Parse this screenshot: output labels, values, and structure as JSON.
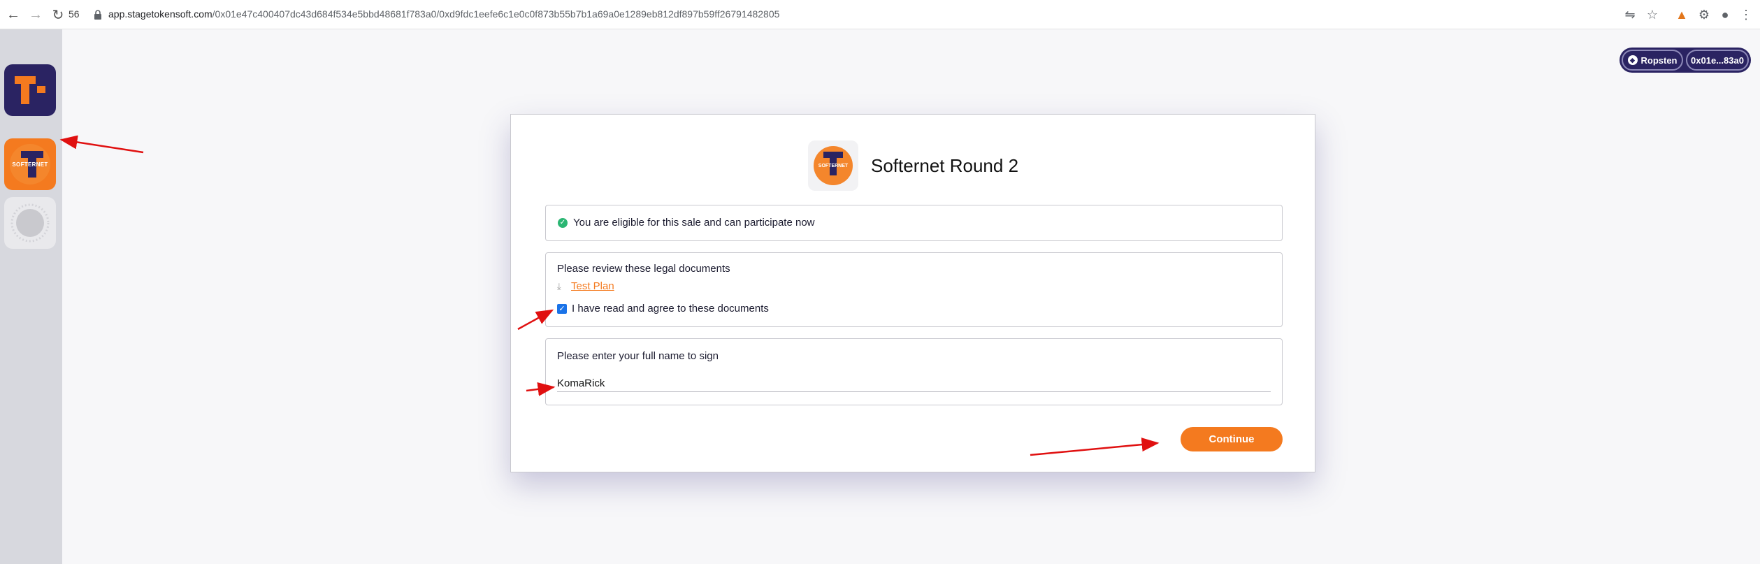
{
  "browser": {
    "tab_count": "56",
    "url_host": "app.stagetokensoft.com",
    "url_path": "/0x01e47c400407dc43d684f534e5bbd48681f783a0/0xd9fdc1eefe6c1e0c0f873b55b7b1a69a0e1289eb812df897b59ff26791482805"
  },
  "rail": {
    "home_logo": "T",
    "project_logo_text": "SOFTERNET"
  },
  "network": {
    "name": "Ropsten",
    "address": "0x01e...83a0"
  },
  "sale": {
    "logo_text": "SOFTERNET",
    "title": "Softernet Round 2",
    "eligibility_message": "You are eligible for this sale and can participate now",
    "legal_heading": "Please review these legal documents",
    "documents": [
      {
        "label": "Test Plan"
      }
    ],
    "agree_label": "I have read and agree to these documents",
    "agree_checked": true,
    "name_heading": "Please enter your full name to sign",
    "name_value": "KomaRick",
    "continue_label": "Continue"
  },
  "colors": {
    "accent": "#f47a1f",
    "brand_dark": "#2a2362",
    "success": "#2bb673",
    "annotation": "#e01010"
  }
}
